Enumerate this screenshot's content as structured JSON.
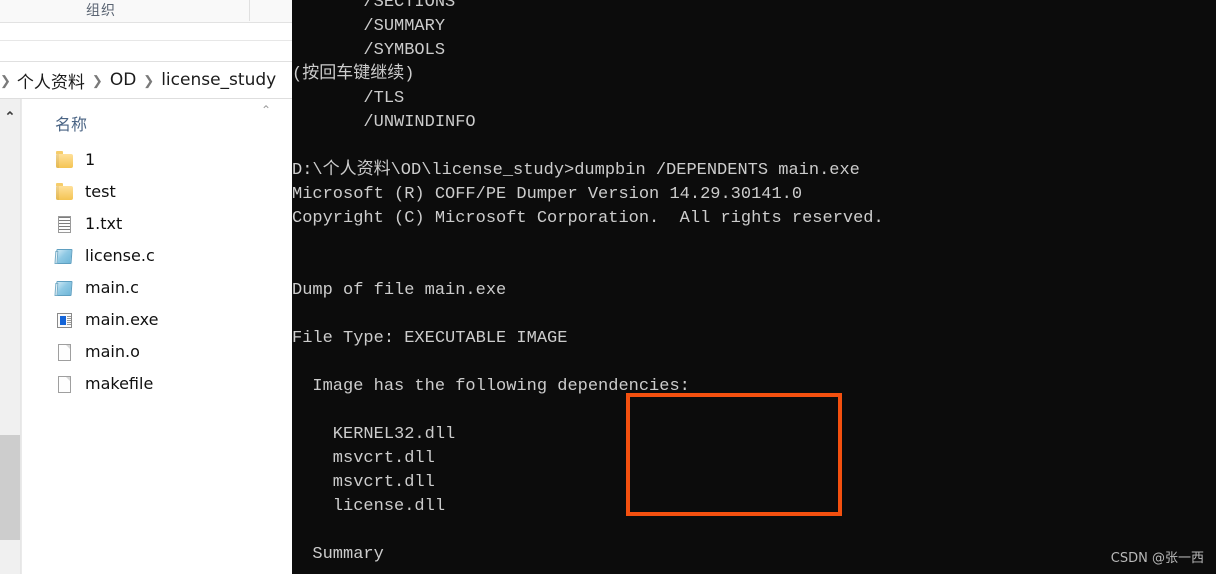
{
  "explorer": {
    "ribbon": {
      "tab_label": "组织"
    },
    "breadcrumb": {
      "lead_chevron": "❯",
      "separator": "❯",
      "items": [
        {
          "label": "个人资料"
        },
        {
          "label": "OD"
        },
        {
          "label": "license_study"
        }
      ]
    },
    "nav": {
      "collapse_chevron": "⌃"
    },
    "column_header": {
      "label": "名称",
      "sort_chevron": "⌃"
    },
    "files": [
      {
        "name": "1",
        "icon": "folder-icon",
        "type": "folder"
      },
      {
        "name": "test",
        "icon": "folder-icon",
        "type": "folder"
      },
      {
        "name": "1.txt",
        "icon": "text-file-icon",
        "type": "txt"
      },
      {
        "name": "license.c",
        "icon": "c-source-icon",
        "type": "csrc"
      },
      {
        "name": "main.c",
        "icon": "c-source-icon",
        "type": "csrc"
      },
      {
        "name": "main.exe",
        "icon": "executable-icon",
        "type": "exe"
      },
      {
        "name": "main.o",
        "icon": "generic-file-icon",
        "type": "doc"
      },
      {
        "name": "makefile",
        "icon": "generic-file-icon",
        "type": "doc"
      }
    ]
  },
  "terminal": {
    "background_color": "#0c0c0c",
    "text_color": "#cccccc",
    "lines": [
      "       /SECTIONS",
      "       /SUMMARY",
      "       /SYMBOLS",
      "(按回车键继续)",
      "       /TLS",
      "       /UNWINDINFO",
      "",
      "D:\\个人资料\\OD\\license_study>dumpbin /DEPENDENTS main.exe",
      "Microsoft (R) COFF/PE Dumper Version 14.29.30141.0",
      "Copyright (C) Microsoft Corporation.  All rights reserved.",
      "",
      "",
      "Dump of file main.exe",
      "",
      "File Type: EXECUTABLE IMAGE",
      "",
      "  Image has the following dependencies:",
      "",
      "    KERNEL32.dll",
      "    msvcrt.dll",
      "    msvcrt.dll",
      "    license.dll",
      "",
      "  Summary"
    ],
    "highlight": {
      "color": "#f4500f",
      "entries": [
        "KERNEL32.dll",
        "msvcrt.dll",
        "msvcrt.dll",
        "license.dll"
      ]
    }
  },
  "watermark": {
    "text": "CSDN @张一西"
  }
}
